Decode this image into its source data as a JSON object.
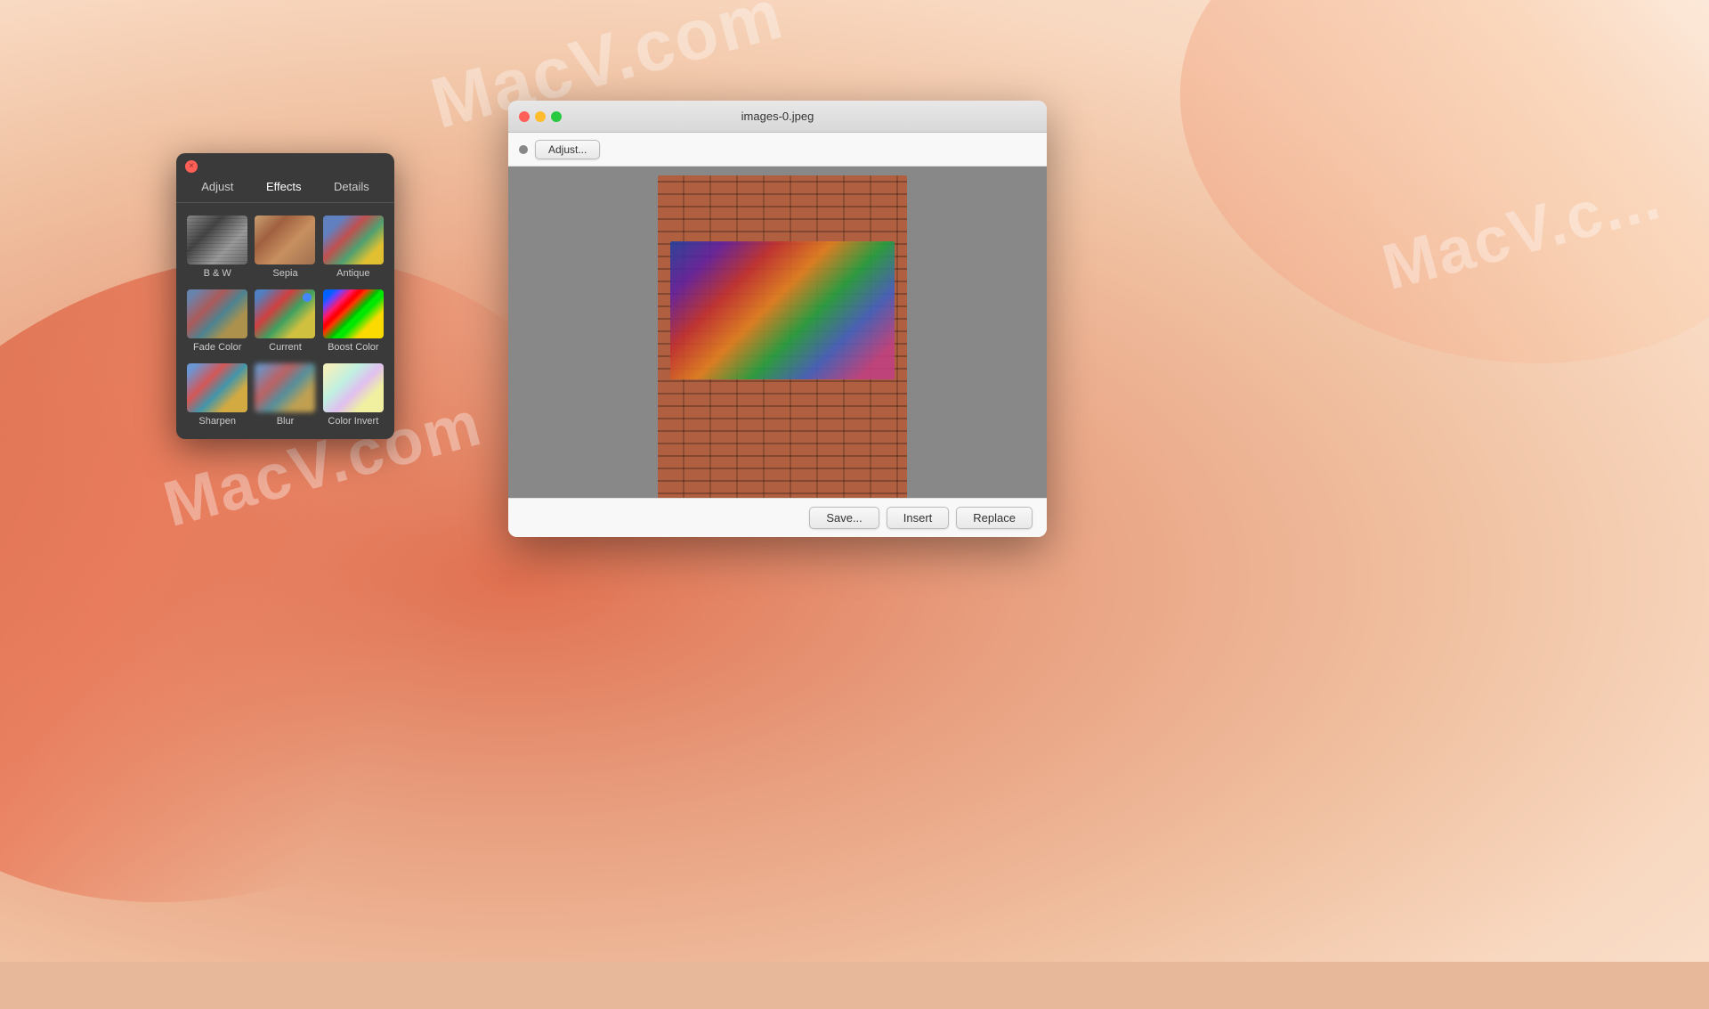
{
  "desktop": {
    "watermarks": [
      "MacV.com",
      "MacV.com",
      "MacV.c..."
    ]
  },
  "effects_panel": {
    "close_btn": "×",
    "tabs": [
      {
        "id": "adjust",
        "label": "Adjust",
        "active": false
      },
      {
        "id": "effects",
        "label": "Effects",
        "active": true
      },
      {
        "id": "details",
        "label": "Details",
        "active": false
      }
    ],
    "filters": [
      {
        "id": "bw",
        "label": "B & W",
        "thumb_class": "thumb-bw"
      },
      {
        "id": "sepia",
        "label": "Sepia",
        "thumb_class": "thumb-sepia"
      },
      {
        "id": "antique",
        "label": "Antique",
        "thumb_class": "thumb-antique"
      },
      {
        "id": "fadecolor",
        "label": "Fade Color",
        "thumb_class": "thumb-fadecolor"
      },
      {
        "id": "current",
        "label": "Current",
        "thumb_class": "thumb-current",
        "active": true
      },
      {
        "id": "boostcolor",
        "label": "Boost Color",
        "thumb_class": "thumb-boost"
      },
      {
        "id": "sharpen",
        "label": "Sharpen",
        "thumb_class": "thumb-sharpen"
      },
      {
        "id": "blur",
        "label": "Blur",
        "thumb_class": "thumb-blur"
      },
      {
        "id": "colorinvert",
        "label": "Color Invert",
        "thumb_class": "thumb-colorinvert"
      }
    ]
  },
  "image_viewer": {
    "title": "images-0.jpeg",
    "toolbar": {
      "adjust_label": "Adjust..."
    },
    "footer": {
      "save_label": "Save...",
      "insert_label": "Insert",
      "replace_label": "Replace"
    }
  }
}
